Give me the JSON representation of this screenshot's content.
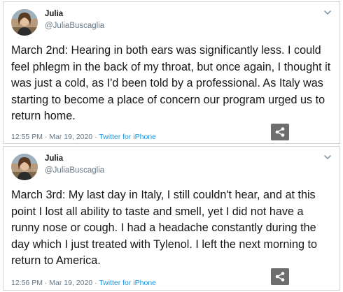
{
  "tweets": [
    {
      "name": "Julia",
      "handle": "@JuliaBuscaglia",
      "text": "March 2nd: Hearing in both ears was significantly less. I could feel phlegm in the back of my throat, but once again, I thought it was just a cold, as I'd been told by a professional. As Italy was starting to become a place of concern our program urged us to return home.",
      "timestamp": "12:55 PM · Mar 19, 2020 · ",
      "source": "Twitter for iPhone"
    },
    {
      "name": "Julia",
      "handle": "@JuliaBuscaglia",
      "text": "March 3rd: My last day in Italy, I still couldn't hear, and at this point I lost all ability to taste and smell, yet I did not have a runny nose or cough. I had a headache constantly during the day which I just treated with Tylenol. I left the next morning to return to America.",
      "timestamp": "12:56 PM · Mar 19, 2020 · ",
      "source": "Twitter for iPhone"
    }
  ],
  "colors": {
    "text": "#14171a",
    "secondary": "#657786",
    "link": "#1b95e0",
    "border": "#cfd3d6",
    "share_bg": "#6e6e6e"
  },
  "icons": {
    "chevron": "chevron-down-icon",
    "share": "share-icon"
  }
}
